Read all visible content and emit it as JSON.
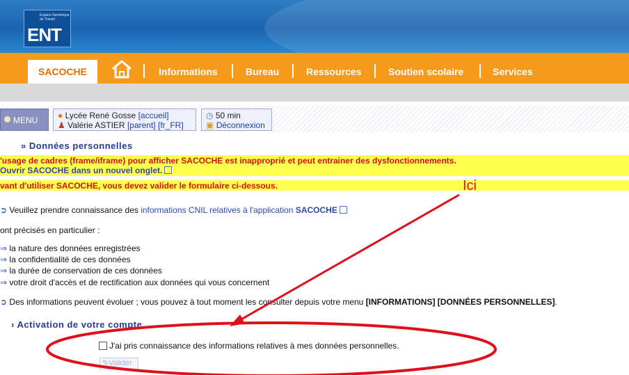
{
  "header": {
    "logo_text": "ENT",
    "logo_small": "Espace Numérique de Travail"
  },
  "nav": {
    "active_tab": "SACOCHE",
    "items": [
      "Informations",
      "Bureau",
      "Ressources",
      "Soutien scolaire",
      "Services"
    ]
  },
  "menubar": {
    "menu_label": "MENU",
    "school": "Lycée René Gosse",
    "home_link": "[accueil]",
    "user": "Valérie ASTIER",
    "role": "[parent]",
    "lang": "[fr_FR]",
    "timer": "50 min",
    "logout": "Déconnexion"
  },
  "page": {
    "title": "Données personnelles",
    "warning_frames": "'usage de cadres (frame/iframe) pour afficher SACOCHE est inapproprié et peut entrainer des dysfonctionnements.",
    "open_tab": "Ouvrir SACOCHE dans un nouvel onglet.",
    "validate_notice": "vant d'utiliser SACOCHE, vous devez valider le formulaire ci-dessous.",
    "cnil_prefix": "Veuillez prendre connaissance des ",
    "cnil_link": "informations CNIL relatives à l'application",
    "cnil_app": "SACOCHE",
    "precises": "ont précisés en particulier :",
    "bullets": [
      "la nature des données enregistrées",
      "la confidentialité de ces données",
      "la durée de conservation de ces données",
      "votre droit d'accès et de rectification aux données qui vous concernent"
    ],
    "evolve_prefix": "Des informations peuvent évoluer ; vous pouvez à tout moment les consulter depuis votre menu ",
    "evolve_menu": "[INFORMATIONS] [DONNÉES PERSONNELLES]",
    "activation_title": "Activation de votre compte",
    "checkbox_label": "J'ai pris connaissance des informations relatives à mes données personnelles.",
    "submit_label": "Valider"
  },
  "annotation": {
    "label": "Ici",
    "color": "#e0101a"
  },
  "colors": {
    "nav_orange": "#f59a1a",
    "warning_yellow": "#ffff4d",
    "title_blue": "#243a94"
  }
}
